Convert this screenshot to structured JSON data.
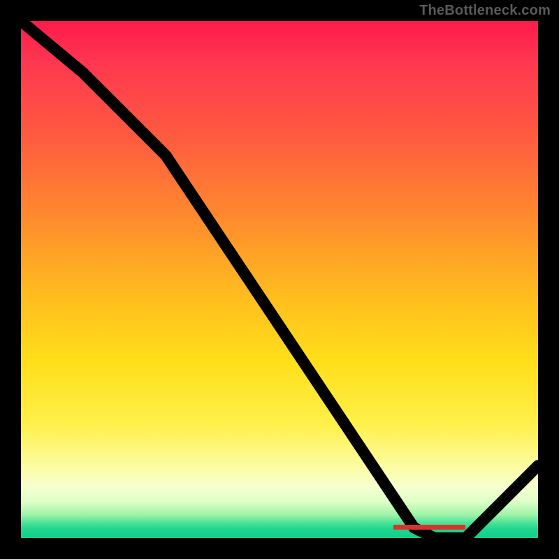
{
  "watermark": "TheBottleneck.com",
  "colors": {
    "frame_bg": "#000000",
    "watermark_text": "#5a5a5a",
    "curve_stroke": "#000000",
    "red_bar": "#d8342e",
    "gradient_stops": [
      {
        "pos": 0.0,
        "color": "#ff1a4b"
      },
      {
        "pos": 0.08,
        "color": "#ff3750"
      },
      {
        "pos": 0.22,
        "color": "#ff5a40"
      },
      {
        "pos": 0.38,
        "color": "#ff8a2e"
      },
      {
        "pos": 0.52,
        "color": "#ffb91f"
      },
      {
        "pos": 0.66,
        "color": "#ffdf1a"
      },
      {
        "pos": 0.78,
        "color": "#fff04a"
      },
      {
        "pos": 0.86,
        "color": "#fdfca0"
      },
      {
        "pos": 0.9,
        "color": "#f7ffcf"
      },
      {
        "pos": 0.93,
        "color": "#ddffc8"
      },
      {
        "pos": 0.955,
        "color": "#9ff3a8"
      },
      {
        "pos": 0.97,
        "color": "#4fe39a"
      },
      {
        "pos": 0.982,
        "color": "#1fd78f"
      },
      {
        "pos": 1.0,
        "color": "#12cf8b"
      }
    ]
  },
  "chart_data": {
    "type": "line",
    "title": "",
    "xlabel": "",
    "ylabel": "",
    "xlim": [
      0,
      100
    ],
    "ylim": [
      0,
      100
    ],
    "series": [
      {
        "name": "curve",
        "x": [
          0,
          12,
          24,
          28,
          40,
          52,
          64,
          72,
          76,
          80,
          86,
          92,
          100
        ],
        "y": [
          100,
          90,
          78,
          74,
          56,
          38,
          20,
          8,
          2,
          0,
          0,
          6,
          14
        ]
      }
    ],
    "annotations": [
      {
        "name": "red-bar",
        "shape": "rect",
        "x0": 72,
        "x1": 86,
        "y": 2,
        "color": "#d8342e"
      }
    ]
  }
}
